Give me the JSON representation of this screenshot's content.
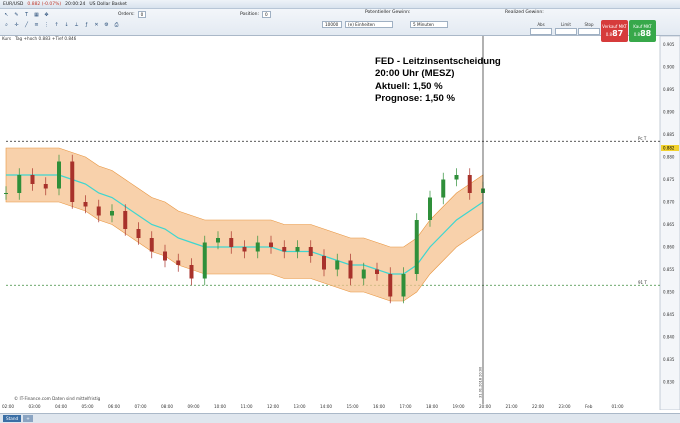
{
  "topbar": {
    "instrument": "EUR/USD",
    "quote": "0.882 (-0.07%)",
    "time": "20:00:24",
    "title": "US Dollar Basket"
  },
  "toolbar": {
    "orders_label": "Orders:",
    "orders_value": "0",
    "position_label": "Position:",
    "position_value": "0",
    "pnl_label": "Potentieller Gewinn:",
    "qty_value": "10000",
    "unit_select": "(e) Einheiten",
    "interval_select": "5 Minuten",
    "realized_label": "Realized Gewinn:",
    "abs_label": "Abs",
    "limit_label": "Limit",
    "stop_label": "Stop",
    "sell_label": "Verkauf MKT",
    "sell_price": "87",
    "sell_prefix": "0.8",
    "buy_label": "Kauf MKT",
    "buy_price": "88",
    "buy_prefix": "0.8"
  },
  "chart_info": {
    "series_tab": "Kurs",
    "summary": "Tag +hoch 0.883 +Tief 0.846"
  },
  "annotation": {
    "line1": "FED - Leitzinsentscheidung",
    "line2": "20:00 Uhr (MESZ)",
    "line3": "Aktuell: 1,50 %",
    "line4": "Prognose: 1,50 %"
  },
  "copyright": "© IT-Finance.com  Daten sind mittelfristig",
  "status_tab": "Stand",
  "colors": {
    "up_candle": "#2f8f3a",
    "down_candle": "#a8322b",
    "band_fill": "#f5c28f",
    "band_line": "#e8953f",
    "ma_line": "#3dd6d0",
    "hline": "#333333"
  },
  "chart_data": {
    "type": "line",
    "title": "",
    "xlabel": "",
    "ylabel": "",
    "ylim": [
      0.826,
      0.906
    ],
    "x_ticks": [
      "02:00",
      "03:00",
      "04:00",
      "05:00",
      "06:00",
      "07:00",
      "08:00",
      "09:00",
      "10:00",
      "11:00",
      "12:00",
      "13:00",
      "14:00",
      "15:00",
      "16:00",
      "17:00",
      "18:00",
      "19:00",
      "20:00",
      "21:00",
      "22:00",
      "23:00",
      "Feb",
      "01:00"
    ],
    "y_ticks": [
      "0.905",
      "0.900",
      "0.895",
      "0.890",
      "0.885",
      "0.880",
      "0.875",
      "0.870",
      "0.865",
      "0.860",
      "0.855",
      "0.850",
      "0.845",
      "0.840",
      "0.835",
      "0.830"
    ],
    "hlines": [
      {
        "label": "Pc T",
        "value": 0.8835
      },
      {
        "label": "91 T",
        "value": 0.8515
      }
    ],
    "last_price": 0.882,
    "event_line_x": "20:00",
    "event_line_label": "31.01.2018 20:00",
    "series": [
      {
        "name": "Kurs",
        "x": [
          2.0,
          2.5,
          3.0,
          3.5,
          4.0,
          4.5,
          5.0,
          5.5,
          6.0,
          6.5,
          7.0,
          7.5,
          8.0,
          8.5,
          9.0,
          9.5,
          10.0,
          10.5,
          11.0,
          11.5,
          12.0,
          12.5,
          13.0,
          13.5,
          14.0,
          14.5,
          15.0,
          15.5,
          16.0,
          16.5,
          17.0,
          17.5,
          18.0,
          18.5,
          19.0,
          19.5,
          20.0
        ],
        "y": [
          0.872,
          0.876,
          0.874,
          0.873,
          0.879,
          0.87,
          0.869,
          0.867,
          0.868,
          0.864,
          0.862,
          0.859,
          0.857,
          0.856,
          0.853,
          0.861,
          0.862,
          0.86,
          0.859,
          0.861,
          0.86,
          0.859,
          0.86,
          0.858,
          0.855,
          0.857,
          0.853,
          0.855,
          0.854,
          0.849,
          0.854,
          0.866,
          0.871,
          0.875,
          0.876,
          0.872,
          0.873
        ]
      },
      {
        "name": "",
        "x": [
          2.0,
          2.5,
          3.0,
          3.5,
          4.0,
          4.5,
          5.0,
          5.5,
          6.0,
          6.5,
          7.0,
          7.5,
          8.0,
          8.5,
          9.0,
          9.5,
          10.0,
          10.5,
          11.0,
          11.5,
          12.0,
          12.5,
          13.0,
          13.5,
          14.0,
          14.5,
          15.0,
          15.5,
          16.0,
          16.5,
          17.0,
          17.5,
          18.0,
          18.5,
          19.0,
          19.5,
          20.0
        ],
        "y": [
          0.876,
          0.876,
          0.876,
          0.876,
          0.876,
          0.875,
          0.874,
          0.872,
          0.871,
          0.869,
          0.867,
          0.865,
          0.864,
          0.862,
          0.861,
          0.86,
          0.86,
          0.86,
          0.86,
          0.86,
          0.86,
          0.859,
          0.859,
          0.859,
          0.858,
          0.857,
          0.856,
          0.856,
          0.855,
          0.854,
          0.854,
          0.856,
          0.86,
          0.863,
          0.866,
          0.868,
          0.87
        ]
      }
    ]
  }
}
